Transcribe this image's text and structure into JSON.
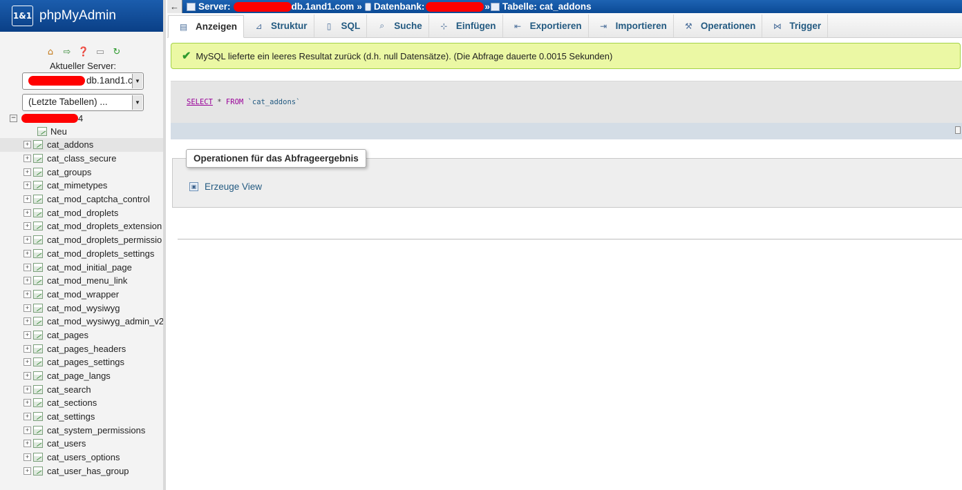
{
  "brand": {
    "logo_text": "1&1",
    "title": "phpMyAdmin"
  },
  "sidebar": {
    "server_label": "Aktueller Server:",
    "server_select_value": "db.1and1.c",
    "recent_select_value": "(Letzte Tabellen) ...",
    "db_name_suffix": "4",
    "new_label": "Neu",
    "tables": [
      "cat_addons",
      "cat_class_secure",
      "cat_groups",
      "cat_mimetypes",
      "cat_mod_captcha_control",
      "cat_mod_droplets",
      "cat_mod_droplets_extension",
      "cat_mod_droplets_permissio",
      "cat_mod_droplets_settings",
      "cat_mod_initial_page",
      "cat_mod_menu_link",
      "cat_mod_wrapper",
      "cat_mod_wysiwyg",
      "cat_mod_wysiwyg_admin_v2",
      "cat_pages",
      "cat_pages_headers",
      "cat_pages_settings",
      "cat_page_langs",
      "cat_search",
      "cat_sections",
      "cat_settings",
      "cat_system_permissions",
      "cat_users",
      "cat_users_options",
      "cat_user_has_group"
    ],
    "active_table": "cat_addons",
    "nav_icons": [
      "home-icon",
      "exit-icon",
      "help-icon",
      "docs-icon",
      "reload-icon"
    ]
  },
  "breadcrumb": {
    "back_glyph": "←",
    "server_label": "Server:",
    "server_host": "db.1and1.com",
    "separator": "»",
    "database_label": "Datenbank:",
    "table_label": "Tabelle: cat_addons"
  },
  "tabs": [
    {
      "label": "Anzeigen",
      "icon": "browse-icon",
      "glyph": "▤"
    },
    {
      "label": "Struktur",
      "icon": "structure-icon",
      "glyph": "⊿"
    },
    {
      "label": "SQL",
      "icon": "sql-icon",
      "glyph": "▯"
    },
    {
      "label": "Suche",
      "icon": "search-icon",
      "glyph": "⌕"
    },
    {
      "label": "Einfügen",
      "icon": "insert-icon",
      "glyph": "⊹"
    },
    {
      "label": "Exportieren",
      "icon": "export-icon",
      "glyph": "⇤"
    },
    {
      "label": "Importieren",
      "icon": "import-icon",
      "glyph": "⇥"
    },
    {
      "label": "Operationen",
      "icon": "wrench-icon",
      "glyph": "⚒"
    },
    {
      "label": "Trigger",
      "icon": "trigger-icon",
      "glyph": "⋈"
    }
  ],
  "active_tab": "Anzeigen",
  "message": {
    "text": "MySQL lieferte ein leeres Resultat zurück (d.h. null Datensätze). (Die Abfrage dauerte 0.0015 Sekunden)"
  },
  "sql": {
    "kw_select": "SELECT",
    "star": "*",
    "kw_from": "FROM",
    "table": "`cat_addons`"
  },
  "operations": {
    "legend": "Operationen für das Abfrageergebnis",
    "create_view_label": "Erzeuge View"
  },
  "colors": {
    "header_blue": "#0b4a95",
    "link_blue": "#235a81",
    "success_bg": "#ebf8a4",
    "sql_keyword": "#990099"
  }
}
